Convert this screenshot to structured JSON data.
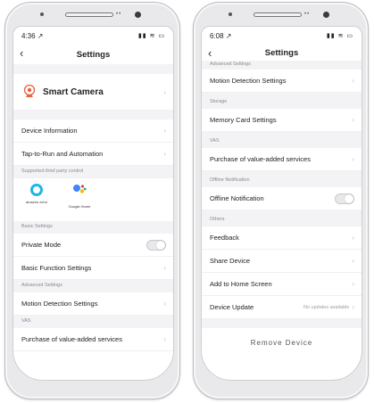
{
  "left_phone": {
    "status": {
      "time": "4:36 ↗",
      "icons": "▮▮ ≋ ▭"
    },
    "header": {
      "title": "Settings"
    },
    "device": {
      "name": "Smart Camera"
    },
    "rows_top": [
      {
        "label": "Device Information"
      },
      {
        "label": "Tap-to-Run and Automation"
      }
    ],
    "third_party": {
      "section_label": "Supported third party control",
      "items": [
        {
          "caption": "amazon echo",
          "icon": "alexa-icon"
        },
        {
          "caption": "Google Home",
          "icon": "google-assistant-icon"
        }
      ]
    },
    "basic_settings": {
      "section_label": "Basic Settings",
      "private_mode_label": "Private Mode",
      "private_mode_on": false,
      "basic_function_label": "Basic Function Settings"
    },
    "advanced_settings": {
      "section_label": "Advanced Settings",
      "motion_label": "Motion Detection Settings"
    },
    "vas": {
      "section_label": "VAS",
      "purchase_label": "Purchase of value-added services"
    }
  },
  "right_phone": {
    "status": {
      "time": "6:08 ↗",
      "icons": "▮▮ ≋ ▭"
    },
    "header": {
      "title": "Settings"
    },
    "advanced_settings": {
      "section_label": "Advanced Settings",
      "motion_label": "Motion Detection Settings"
    },
    "storage": {
      "section_label": "Storage",
      "memory_label": "Memory Card Settings"
    },
    "vas": {
      "section_label": "VAS",
      "purchase_label": "Purchase of value-added services"
    },
    "offline": {
      "section_label": "Offline Notification",
      "offline_label": "Offline Notification",
      "offline_on": false
    },
    "others": {
      "section_label": "Others",
      "feedback_label": "Feedback",
      "share_label": "Share Device",
      "add_home_label": "Add to Home Screen",
      "update_label": "Device Update",
      "update_hint": "No updates available"
    },
    "footer_partial": "Remove Device"
  },
  "colors": {
    "section_bg": "#f3f3f5",
    "alexa_blue": "#1fb6e8",
    "camera_orange": "#e8613c",
    "chevron": "#c4c4c8"
  }
}
